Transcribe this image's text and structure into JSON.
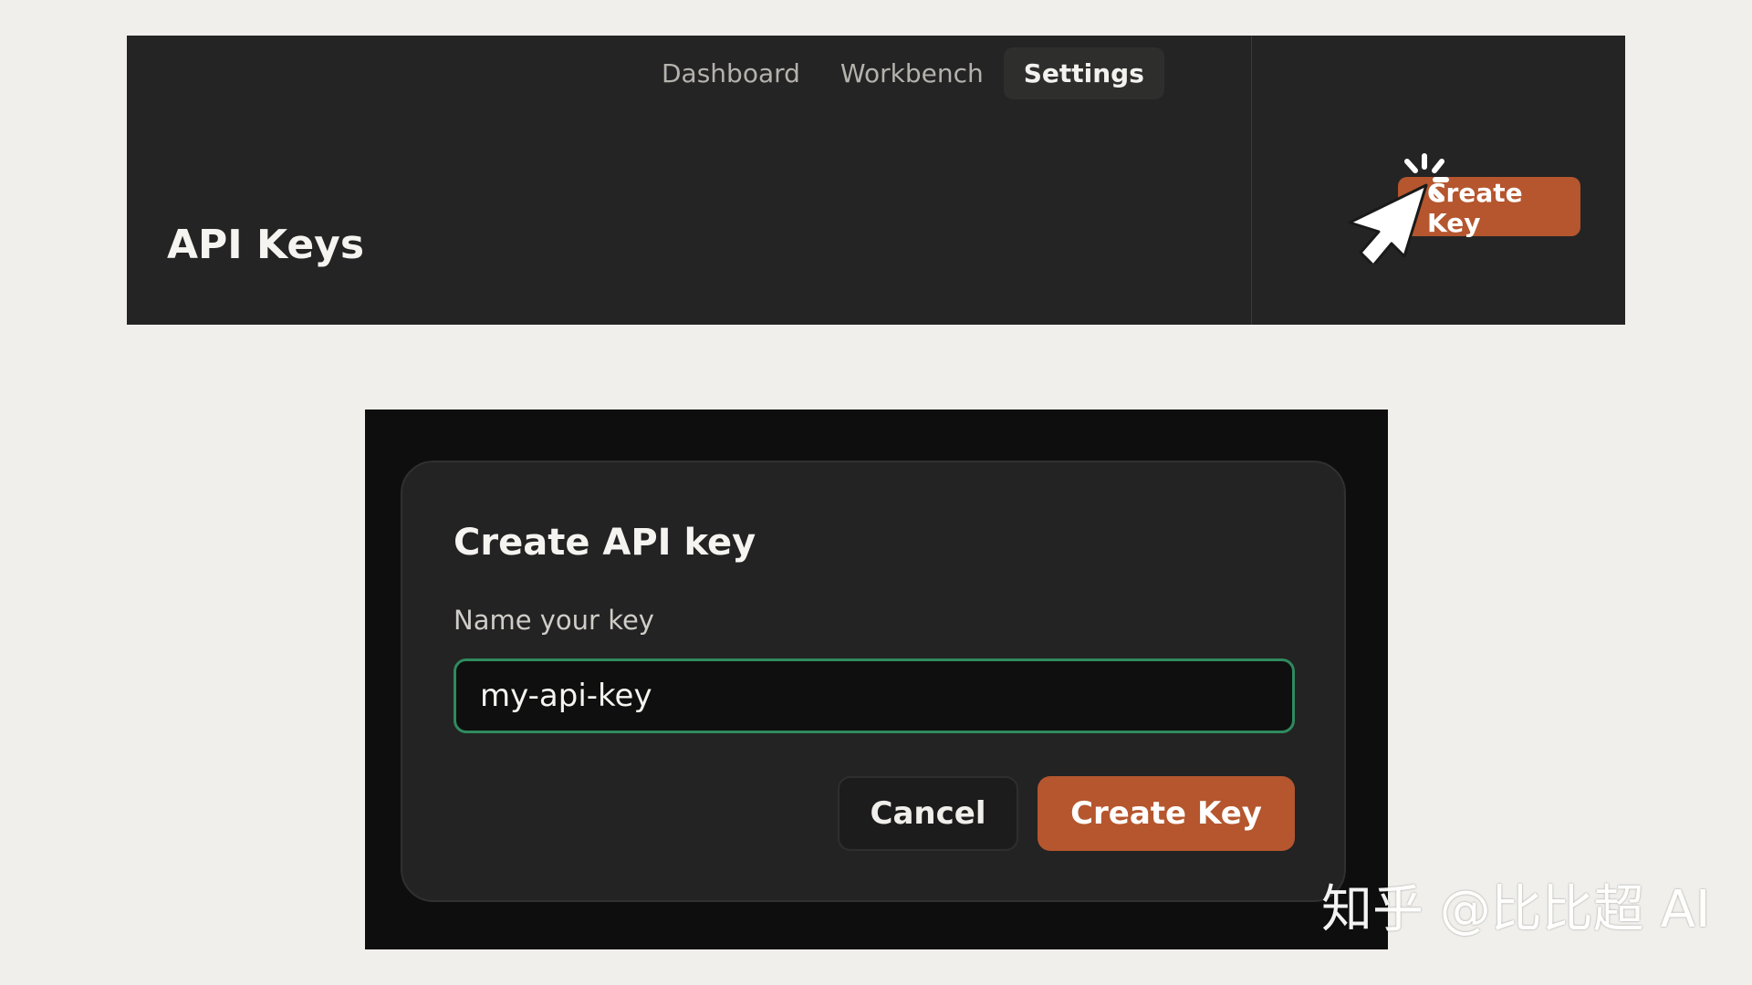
{
  "header": {
    "nav_tabs": [
      {
        "label": "Dashboard",
        "active": false
      },
      {
        "label": "Workbench",
        "active": false
      },
      {
        "label": "Settings",
        "active": true
      }
    ],
    "page_title": "API Keys",
    "create_key_button": "Create Key"
  },
  "dialog": {
    "title": "Create API key",
    "field_label": "Name your key",
    "input_value": "my-api-key",
    "cancel_button": "Cancel",
    "create_button": "Create Key"
  },
  "watermark": "知乎 @比比超 AI",
  "colors": {
    "accent": "#b5562e",
    "input_focus_border": "#2f8a5e",
    "panel_bg": "#242424",
    "dialog_bg": "#232323",
    "page_bg": "#f0efeb"
  },
  "icons": {
    "cursor": "pointer-cursor-click-icon"
  }
}
